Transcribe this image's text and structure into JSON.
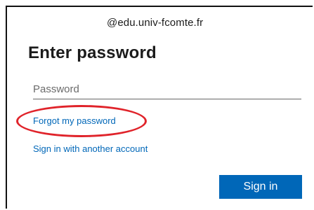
{
  "account": {
    "email": "@edu.univ-fcomte.fr"
  },
  "page": {
    "title": "Enter password"
  },
  "password": {
    "placeholder": "Password",
    "value": ""
  },
  "links": {
    "forgot_password": "Forgot my password",
    "other_account": "Sign in with another account"
  },
  "buttons": {
    "sign_in": "Sign in"
  },
  "colors": {
    "accent": "#0067b8",
    "highlight": "#e0232a",
    "text": "#1b1b1b"
  }
}
